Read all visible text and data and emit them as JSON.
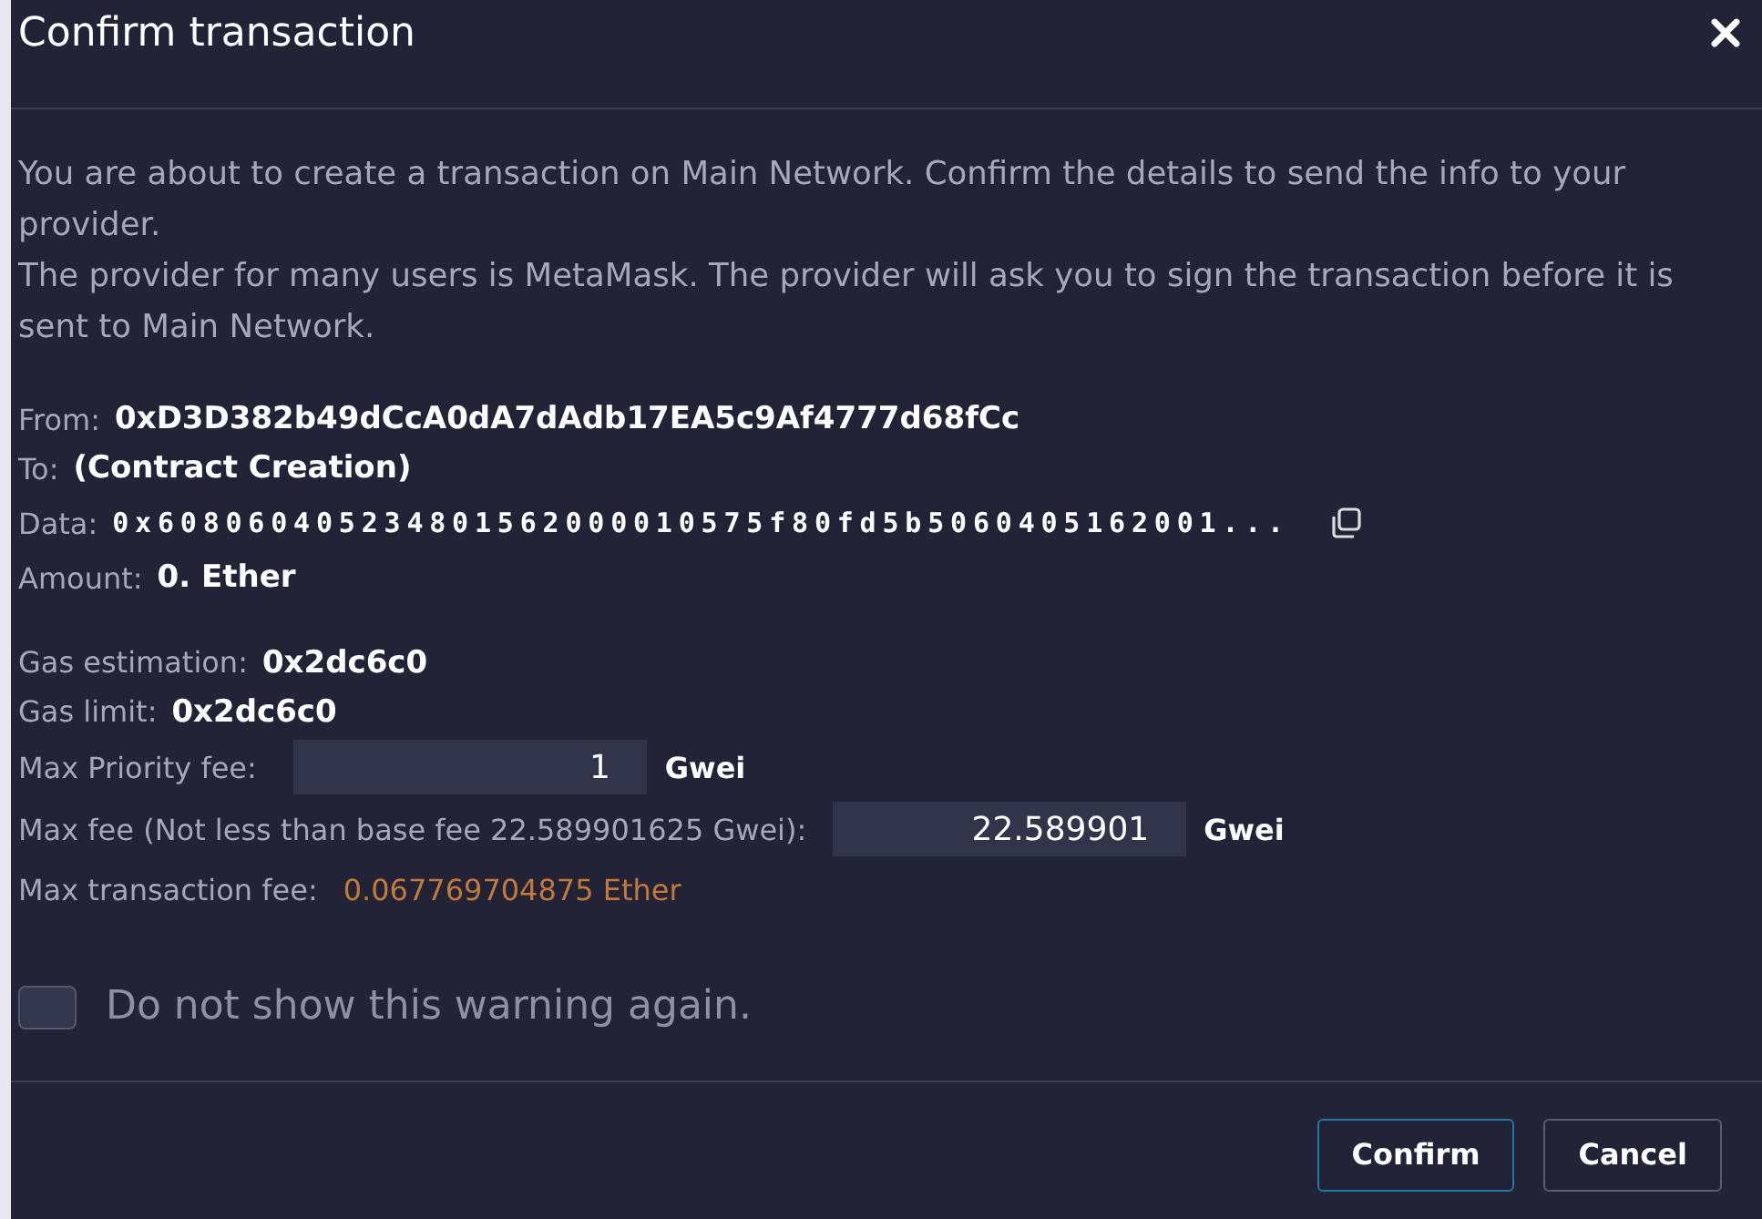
{
  "header": {
    "title": "Confirm transaction"
  },
  "intro": [
    "You are about to create a transaction on Main Network. Confirm the details to send the info to your provider.",
    "The provider for many users is MetaMask. The provider will ask you to sign the transaction before it is sent to Main Network."
  ],
  "details": [
    {
      "kind": "text",
      "label": "From:",
      "value": "0xD3D382b49dCcA0dA7dAdb17EA5c9Af4777d68fCc"
    },
    {
      "kind": "text",
      "label": "To:",
      "value": "(Contract Creation)"
    },
    {
      "kind": "data",
      "label": "Data:",
      "value": "0x608060405234801562000010575f80fd5b5060405162001..."
    },
    {
      "kind": "text",
      "label": "Amount:",
      "value": "0. Ether"
    }
  ],
  "gas": [
    {
      "kind": "text",
      "label": "Gas estimation:",
      "value": "0x2dc6c0"
    },
    {
      "kind": "text",
      "label": "Gas limit:",
      "value": "0x2dc6c0"
    },
    {
      "kind": "input",
      "label": "Max Priority fee:",
      "value": "1",
      "unit": "Gwei"
    },
    {
      "kind": "input",
      "label": "Max fee (Not less than base fee 22.589901625 Gwei):",
      "value": "22.589901",
      "unit": "Gwei"
    },
    {
      "kind": "fee",
      "label": "Max transaction fee:",
      "value": "0.067769704875 Ether"
    }
  ],
  "checkbox": {
    "label": "Do not show this warning again.",
    "checked": false
  },
  "buttons": [
    {
      "label": "Confirm",
      "primary": true
    },
    {
      "label": "Cancel",
      "primary": false
    }
  ]
}
